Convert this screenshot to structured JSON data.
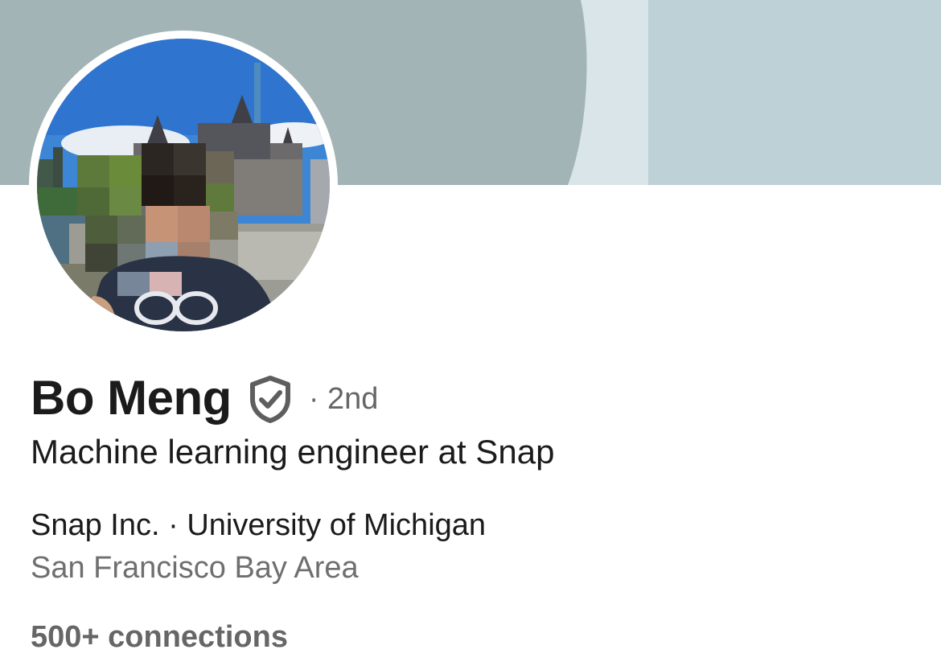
{
  "profile": {
    "name": "Bo Meng",
    "verified_icon": "shield-check-icon",
    "degree": "· 2nd",
    "headline": "Machine learning engineer at Snap",
    "company": "Snap Inc.",
    "separator": "·",
    "school": "University of Michigan",
    "location": "San Francisco Bay Area",
    "connections": "500+ connections"
  },
  "colors": {
    "banner_dark": "#a2b4b6",
    "banner_light": "#bdd1d6",
    "banner_stripe": "#d9e5e8",
    "text_primary": "#1b1b1b",
    "text_secondary": "#6f6f6f"
  }
}
